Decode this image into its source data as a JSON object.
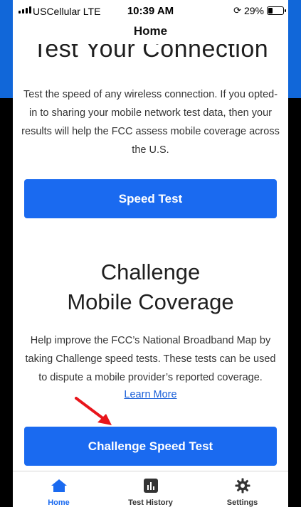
{
  "status_bar": {
    "carrier": "USCellular  LTE",
    "time": "10:39 AM",
    "battery_text": "29%",
    "battery_level": 0.29
  },
  "nav": {
    "title": "Home"
  },
  "section1": {
    "heading": "Test Your Connection",
    "body": "Test the speed of any wireless connection. If you opted-in to sharing your mobile network test data, then your results will help the FCC assess mobile coverage across the U.S.",
    "button": "Speed Test"
  },
  "section2": {
    "heading_line1": "Challenge",
    "heading_line2": "Mobile Coverage",
    "body": "Help improve the FCC’s National Broadband Map by taking Challenge speed tests. These tests can be used to dispute a mobile provider’s reported coverage.",
    "link": "Learn More",
    "button": "Challenge Speed Test"
  },
  "tabbar": {
    "items": [
      {
        "label": "Home",
        "icon": "home-icon",
        "active": true
      },
      {
        "label": "Test History",
        "icon": "chart-icon",
        "active": false
      },
      {
        "label": "Settings",
        "icon": "gear-icon",
        "active": false
      }
    ]
  },
  "colors": {
    "accent": "#1a6af0",
    "annotation_arrow": "#e8151b",
    "background_band": "#1167d9"
  }
}
